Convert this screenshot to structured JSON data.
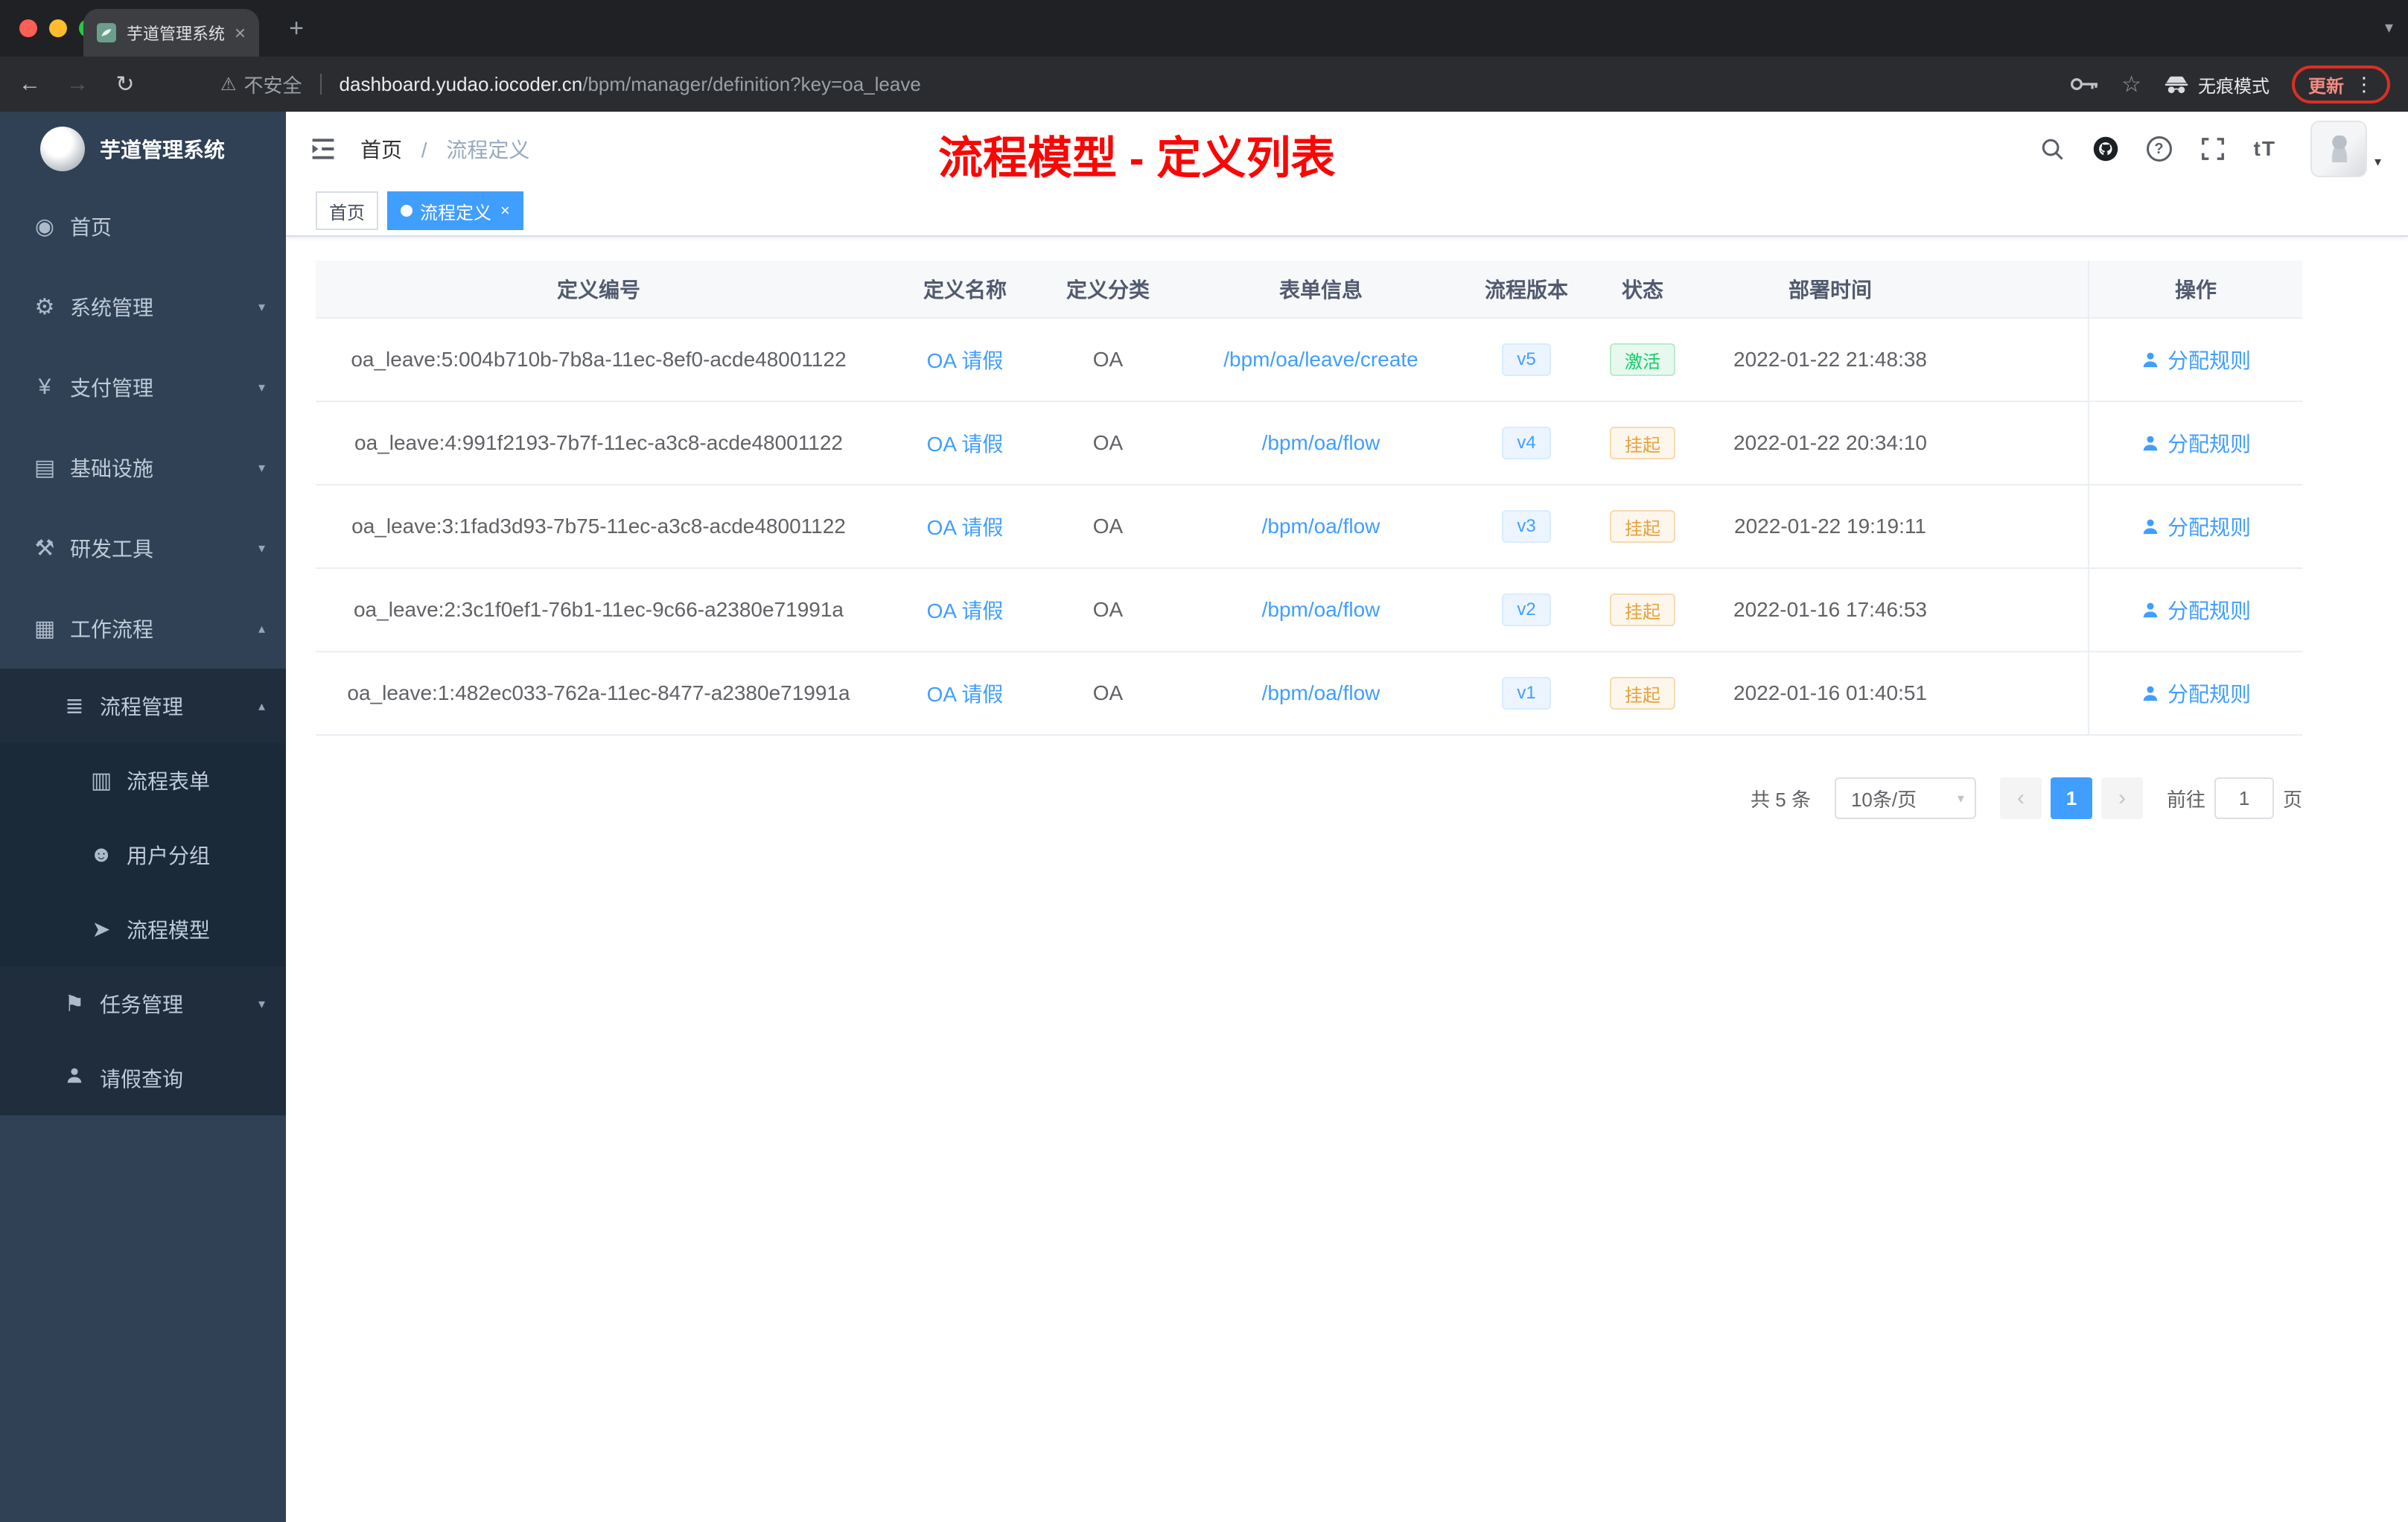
{
  "icons": {
    "close_tab": "×",
    "new_tab": "+",
    "tab_list_caret": "▾",
    "back": "←",
    "forward": "→",
    "reload": "↻",
    "warning": "⚠",
    "star": "☆",
    "menu_dots": "⋮",
    "dashboard": "◉",
    "gear": "⚙",
    "yen": "¥",
    "infrastructure": "▤",
    "tools": "⚒",
    "workflow": "▦",
    "process_list": "≣",
    "form": "▥",
    "user_group": "☻",
    "model": "➤",
    "task": "⚑",
    "chevron_down": "▾",
    "chevron_up": "▴",
    "question": "?",
    "font_size": "tT",
    "prev": "‹",
    "next": "›",
    "select_caret": "▾",
    "tag_close": "×",
    "avatar_caret": "▾"
  },
  "browser": {
    "tab_title": "芋道管理系统",
    "security_label": "不安全",
    "url_host": "dashboard.yudao.iocoder.cn",
    "url_path": "/bpm/manager/definition?key=oa_leave",
    "incognito_label": "无痕模式",
    "update_label": "更新"
  },
  "sidebar": {
    "logo_title": "芋道管理系统",
    "items": [
      {
        "label": "首页"
      },
      {
        "label": "系统管理"
      },
      {
        "label": "支付管理"
      },
      {
        "label": "基础设施"
      },
      {
        "label": "研发工具"
      },
      {
        "label": "工作流程"
      },
      {
        "label": "流程管理"
      },
      {
        "label": "流程表单"
      },
      {
        "label": "用户分组"
      },
      {
        "label": "流程模型"
      },
      {
        "label": "任务管理"
      },
      {
        "label": "请假查询"
      }
    ]
  },
  "header": {
    "breadcrumb_home": "首页",
    "breadcrumb_separator": "/",
    "breadcrumb_current": "流程定义",
    "annotation_title": "流程模型 - 定义列表"
  },
  "tags": {
    "home": "首页",
    "active": "流程定义"
  },
  "table": {
    "columns": {
      "id": "定义编号",
      "name": "定义名称",
      "category": "定义分类",
      "form": "表单信息",
      "version": "流程版本",
      "status": "状态",
      "deploy_time": "部署时间",
      "action": "操作"
    },
    "rows": [
      {
        "id": "oa_leave:5:004b710b-7b8a-11ec-8ef0-acde48001122",
        "name": "OA 请假",
        "category": "OA",
        "form": "/bpm/oa/leave/create",
        "version": "v5",
        "status": "激活",
        "deploy_time": "2022-01-22 21:48:38",
        "action": "分配规则"
      },
      {
        "id": "oa_leave:4:991f2193-7b7f-11ec-a3c8-acde48001122",
        "name": "OA 请假",
        "category": "OA",
        "form": "/bpm/oa/flow",
        "version": "v4",
        "status": "挂起",
        "deploy_time": "2022-01-22 20:34:10",
        "action": "分配规则"
      },
      {
        "id": "oa_leave:3:1fad3d93-7b75-11ec-a3c8-acde48001122",
        "name": "OA 请假",
        "category": "OA",
        "form": "/bpm/oa/flow",
        "version": "v3",
        "status": "挂起",
        "deploy_time": "2022-01-22 19:19:11",
        "action": "分配规则"
      },
      {
        "id": "oa_leave:2:3c1f0ef1-76b1-11ec-9c66-a2380e71991a",
        "name": "OA 请假",
        "category": "OA",
        "form": "/bpm/oa/flow",
        "version": "v2",
        "status": "挂起",
        "deploy_time": "2022-01-16 17:46:53",
        "action": "分配规则"
      },
      {
        "id": "oa_leave:1:482ec033-762a-11ec-8477-a2380e71991a",
        "name": "OA 请假",
        "category": "OA",
        "form": "/bpm/oa/flow",
        "version": "v1",
        "status": "挂起",
        "deploy_time": "2022-01-16 01:40:51",
        "action": "分配规则"
      }
    ]
  },
  "pagination": {
    "total": "共 5 条",
    "page_size": "10条/页",
    "current_page": "1",
    "goto_label": "前往",
    "goto_value": "1",
    "goto_unit": "页"
  },
  "colors": {
    "accent": "#409eff",
    "success": "#13ce66",
    "warning": "#e6a23c",
    "annotation_red": "#fb0505",
    "sidebar_bg": "#304156"
  }
}
